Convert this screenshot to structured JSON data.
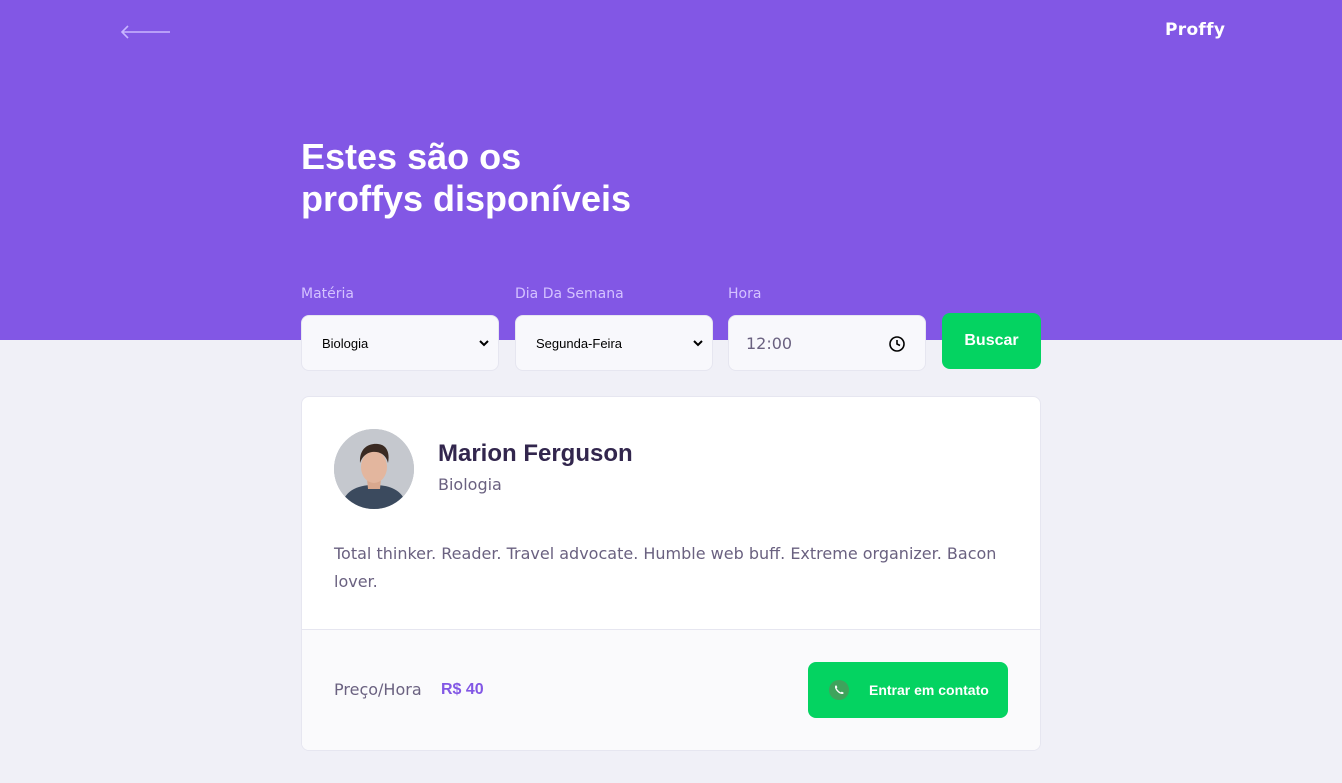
{
  "header": {
    "logo": "Proffy",
    "back_icon": "arrow-left-icon"
  },
  "page": {
    "title_line1": "Estes são os",
    "title_line2": "proffys disponíveis"
  },
  "filters": {
    "subject": {
      "label": "Matéria",
      "value": "Biologia"
    },
    "weekday": {
      "label": "Dia Da Semana",
      "value": "Segunda-Feira"
    },
    "time": {
      "label": "Hora",
      "value": "12:00"
    },
    "search_label": "Buscar"
  },
  "teachers": [
    {
      "name": "Marion Ferguson",
      "subject": "Biologia",
      "bio": "Total thinker. Reader. Travel advocate. Humble web buff. Extreme organizer. Bacon lover.",
      "price_label": "Preço/Hora",
      "price": "R$ 40",
      "contact_label": "Entrar em contato",
      "contact_icon": "whatsapp-icon"
    }
  ],
  "colors": {
    "primary": "#8257E5",
    "secondary": "#04D361",
    "background": "#F0F0F7",
    "title": "#32264D",
    "text": "#6A6180"
  }
}
